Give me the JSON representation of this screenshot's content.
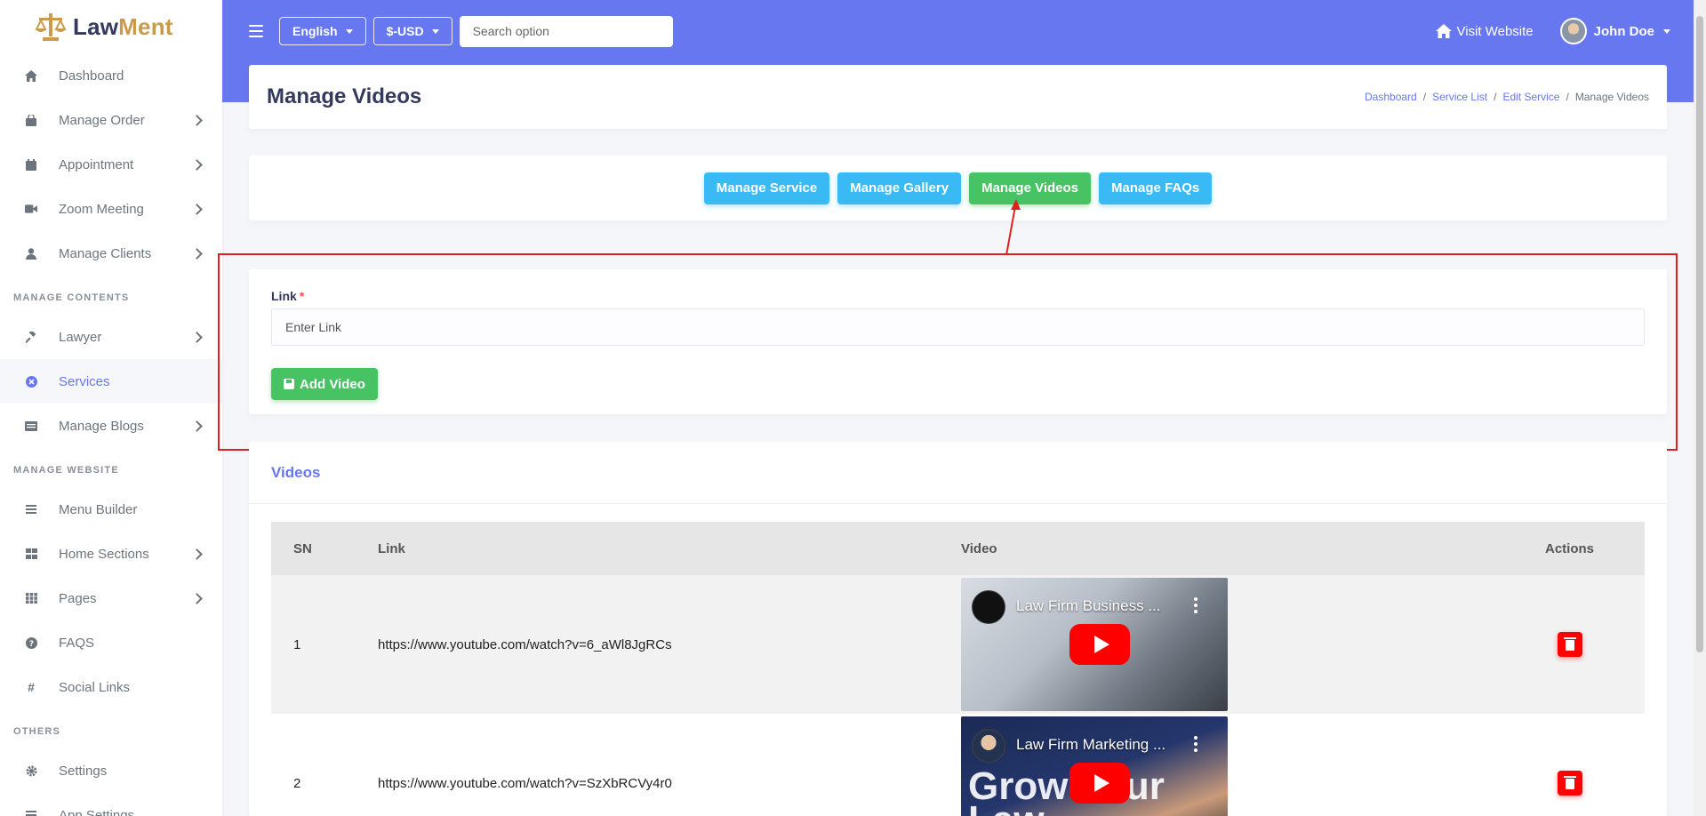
{
  "brand": {
    "name_part1": "Law",
    "name_part2": "Ment"
  },
  "sidebar": {
    "items_top": [
      {
        "label": "Dashboard",
        "icon": "home-icon",
        "chevron": false
      },
      {
        "label": "Manage Order",
        "icon": "bag-icon",
        "chevron": true
      },
      {
        "label": "Appointment",
        "icon": "calendar-icon",
        "chevron": true
      },
      {
        "label": "Zoom Meeting",
        "icon": "video-icon",
        "chevron": true
      },
      {
        "label": "Manage Clients",
        "icon": "user-icon",
        "chevron": true
      }
    ],
    "header_contents": "MANAGE CONTENTS",
    "items_contents": [
      {
        "label": "Lawyer",
        "icon": "gavel-icon",
        "chevron": true
      },
      {
        "label": "Services",
        "icon": "services-icon",
        "chevron": false,
        "active": true
      },
      {
        "label": "Manage Blogs",
        "icon": "blog-icon",
        "chevron": true
      }
    ],
    "header_website": "MANAGE WEBSITE",
    "items_website": [
      {
        "label": "Menu Builder",
        "icon": "bars-icon",
        "chevron": false
      },
      {
        "label": "Home Sections",
        "icon": "grid-icon",
        "chevron": true
      },
      {
        "label": "Pages",
        "icon": "pages-icon",
        "chevron": true
      },
      {
        "label": "FAQS",
        "icon": "question-icon",
        "chevron": false
      },
      {
        "label": "Social Links",
        "icon": "hash-icon",
        "chevron": false
      }
    ],
    "header_others": "OTHERS",
    "items_others": [
      {
        "label": "Settings",
        "icon": "gear-icon",
        "chevron": false
      },
      {
        "label": "App Settings",
        "icon": "bars-icon",
        "chevron": false
      }
    ]
  },
  "topbar": {
    "language": "English",
    "currency": "$-USD",
    "search_placeholder": "Search option",
    "visit_website": "Visit Website",
    "user_name": "John Doe"
  },
  "header": {
    "title": "Manage Videos",
    "breadcrumb": [
      "Dashboard",
      "Service List",
      "Edit Service",
      "Manage Videos"
    ]
  },
  "tabs": {
    "manage_service": "Manage Service",
    "manage_gallery": "Manage Gallery",
    "manage_videos": "Manage Videos",
    "manage_faqs": "Manage FAQs"
  },
  "form": {
    "label": "Link",
    "required_mark": "*",
    "placeholder": "Enter Link",
    "submit": "Add Video"
  },
  "videos": {
    "heading": "Videos",
    "columns": {
      "sn": "SN",
      "link": "Link",
      "video": "Video",
      "actions": "Actions"
    },
    "rows": [
      {
        "sn": "1",
        "link": "https://www.youtube.com/watch?v=6_aWl8JgRCs",
        "video_title": "Law Firm Business ..."
      },
      {
        "sn": "2",
        "link": "https://www.youtube.com/watch?v=SzXbRCVy4r0",
        "video_title": "Law Firm Marketing ...",
        "overlay_text": "Grow Your Law"
      }
    ]
  },
  "colors": {
    "primary": "#6777ef",
    "success": "#47c363",
    "info": "#3abaf4",
    "danger": "#fc0303",
    "annotation": "#e02020"
  }
}
